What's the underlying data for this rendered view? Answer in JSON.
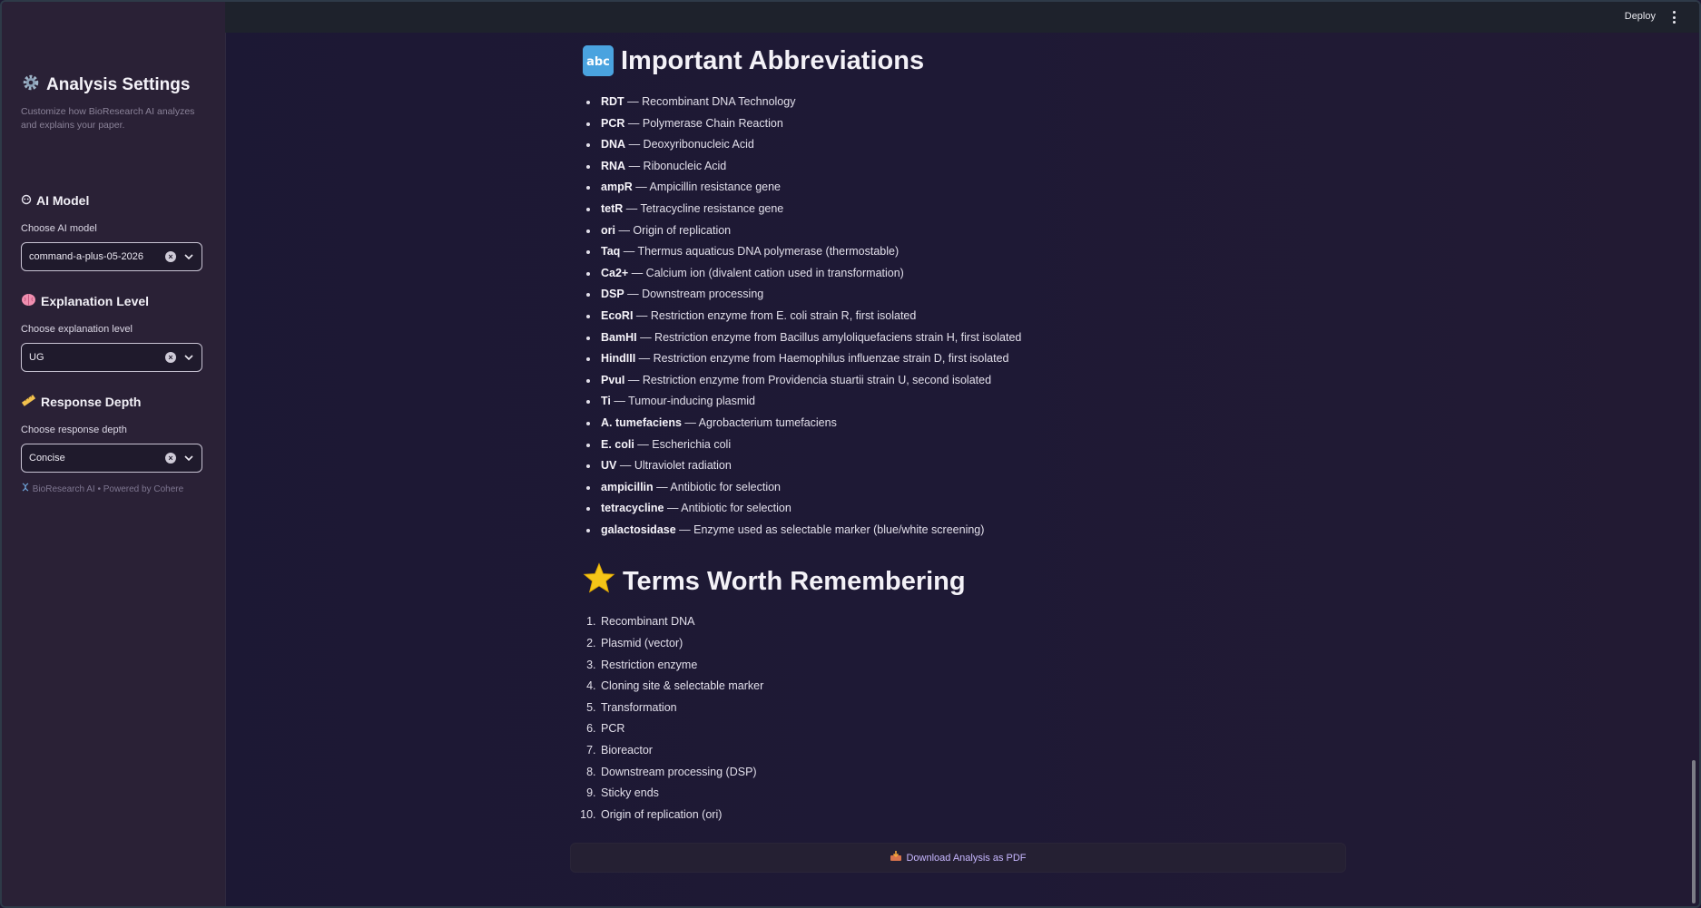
{
  "topbar": {
    "deploy_label": "Deploy"
  },
  "sidebar": {
    "title": "Analysis Settings",
    "description": "Customize how BioResearch AI analyzes and explains your paper.",
    "model": {
      "section": "AI Model",
      "label": "Choose AI model",
      "value": "command-a-plus-05-2026"
    },
    "level": {
      "section": "Explanation Level",
      "label": "Choose explanation level",
      "value": "UG"
    },
    "depth": {
      "section": "Response Depth",
      "label": "Choose response depth",
      "value": "Concise"
    },
    "footer": "BioResearch AI • Powered by Cohere"
  },
  "main": {
    "abbreviations_heading": "Important Abbreviations",
    "abbreviations": [
      {
        "term": "RDT",
        "def": " — Recombinant DNA Technology"
      },
      {
        "term": "PCR",
        "def": " — Polymerase Chain Reaction"
      },
      {
        "term": "DNA",
        "def": " — Deoxyribonucleic Acid"
      },
      {
        "term": "RNA",
        "def": " — Ribonucleic Acid"
      },
      {
        "term": "ampR",
        "def": " — Ampicillin resistance gene"
      },
      {
        "term": "tetR",
        "def": " — Tetracycline resistance gene"
      },
      {
        "term": "ori",
        "def": " — Origin of replication"
      },
      {
        "term": "Taq",
        "def": " — Thermus aquaticus DNA polymerase (thermostable)"
      },
      {
        "term": "Ca2+",
        "def": " — Calcium ion (divalent cation used in transformation)"
      },
      {
        "term": "DSP",
        "def": " — Downstream processing"
      },
      {
        "term": "EcoRI",
        "def": " — Restriction enzyme from E. coli strain R, first isolated"
      },
      {
        "term": "BamHI",
        "def": " — Restriction enzyme from Bacillus amyloliquefaciens strain H, first isolated"
      },
      {
        "term": "HindIII",
        "def": " — Restriction enzyme from Haemophilus influenzae strain D, first isolated"
      },
      {
        "term": "PvuI",
        "def": " — Restriction enzyme from Providencia stuartii strain U, second isolated"
      },
      {
        "term": "Ti",
        "def": " — Tumour-inducing plasmid"
      },
      {
        "term": "A. tumefaciens",
        "def": " — Agrobacterium tumefaciens"
      },
      {
        "term": "E. coli",
        "def": " — Escherichia coli"
      },
      {
        "term": "UV",
        "def": " — Ultraviolet radiation"
      },
      {
        "term": "ampicillin",
        "def": " — Antibiotic for selection"
      },
      {
        "term": "tetracycline",
        "def": " — Antibiotic for selection"
      },
      {
        "term": "galactosidase",
        "def": " — Enzyme used as selectable marker (blue/white screening)"
      }
    ],
    "terms_heading": "Terms Worth Remembering",
    "terms": [
      "Recombinant DNA",
      "Plasmid (vector)",
      "Restriction enzyme",
      "Cloning site & selectable marker",
      "Transformation",
      "PCR",
      "Bioreactor",
      "Downstream processing (DSP)",
      "Sticky ends",
      "Origin of replication (ori)"
    ],
    "download_label": "Download Analysis as PDF"
  },
  "colors": {
    "sidebar_bg": "#2a2136",
    "main_bg": "#1e1935",
    "accent_link": "#c7b7ff",
    "star": "#f5c518",
    "abc_badge": "#4aa3df"
  },
  "icons": {
    "settings": "gear-icon",
    "model": "robot-icon",
    "level": "brain-icon",
    "depth": "ruler-icon",
    "footer": "dna-icon",
    "abbreviations": "abc-icon",
    "terms": "star-icon",
    "download": "inbox-tray-icon"
  }
}
